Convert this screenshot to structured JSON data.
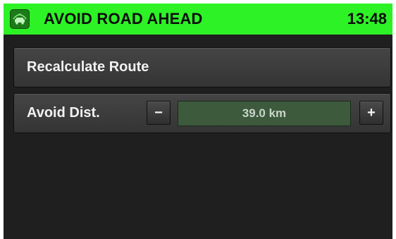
{
  "header": {
    "title": "AVOID ROAD AHEAD",
    "time": "13:48",
    "icon": "avoid-road-icon",
    "background_color": "#2df226"
  },
  "recalculate": {
    "label": "Recalculate Route"
  },
  "avoid_distance": {
    "label": "Avoid Dist.",
    "minus_label": "−",
    "plus_label": "+",
    "value": "39.0 km"
  }
}
